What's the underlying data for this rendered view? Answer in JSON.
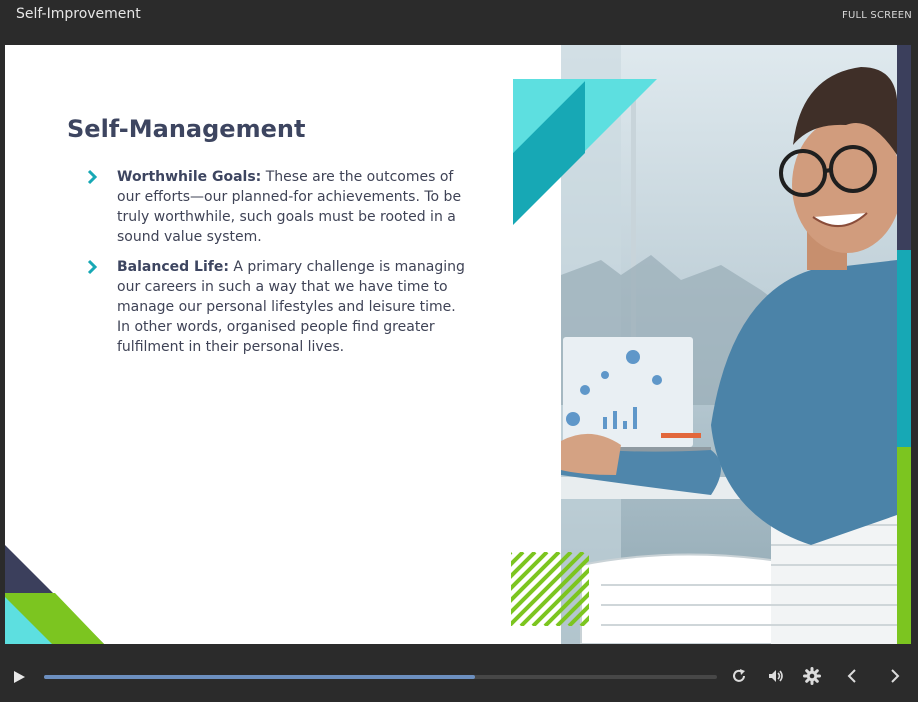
{
  "header": {
    "title": "Self-Improvement",
    "fullscreen_label": "FULL SCREEN"
  },
  "slide": {
    "title": "Self-Management",
    "bullets": [
      {
        "term": "Worthwhile Goals:",
        "text": " These are the outcomes of our efforts—our planned-for achievements. To be truly worthwhile, such goals must be rooted in a sound value system."
      },
      {
        "term": "Balanced Life:",
        "text": " A primary challenge is managing our careers in such a way that we have time to manage our personal lifestyles and leisure time. In other words, organised people find greater fulfilment in their personal lives."
      }
    ]
  },
  "player": {
    "progress_fraction": 0.64
  },
  "icons": [
    "chevron-right-icon",
    "play-icon",
    "replay-icon",
    "volume-icon",
    "gear-icon",
    "previous-icon",
    "next-icon"
  ],
  "colors": {
    "title": "#3d4560",
    "accent_teal": "#17a8b5",
    "accent_cyan": "#5ddfe0",
    "accent_green": "#7cc520",
    "navy": "#3b3f5c",
    "chrome": "#2b2b2b",
    "progress": "#6c8fbf"
  }
}
